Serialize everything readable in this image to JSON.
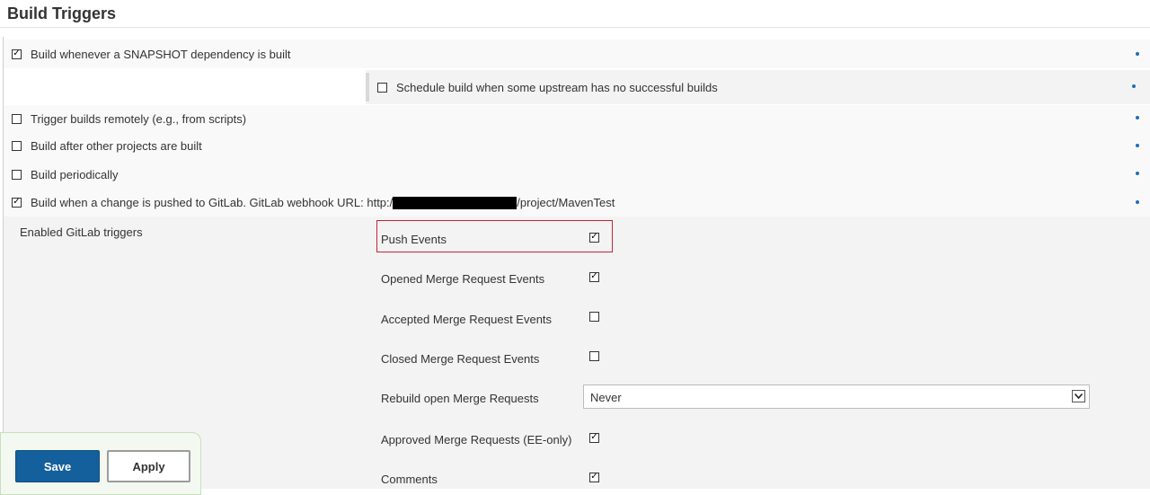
{
  "section": {
    "title": "Build Triggers"
  },
  "triggers": [
    {
      "label": "Build whenever a SNAPSHOT dependency is built",
      "checked": true
    },
    {
      "label": "Schedule build when some upstream has no successful builds",
      "checked": false
    },
    {
      "label": "Trigger builds remotely (e.g., from scripts)",
      "checked": false
    },
    {
      "label": "Build after other projects are built",
      "checked": false
    },
    {
      "label": "Build periodically",
      "checked": false
    },
    {
      "label_prefix": "Build when a change is pushed to GitLab. GitLab webhook URL: http:/",
      "label_suffix": "/project/MavenTest",
      "checked": true
    }
  ],
  "gitlab": {
    "panel_label": "Enabled GitLab triggers",
    "options": [
      {
        "label": "Push Events",
        "checked": true
      },
      {
        "label": "Opened Merge Request Events",
        "checked": true
      },
      {
        "label": "Accepted Merge Request Events",
        "checked": false
      },
      {
        "label": "Closed Merge Request Events",
        "checked": false
      },
      {
        "label": "Rebuild open Merge Requests",
        "select_value": "Never"
      },
      {
        "label": "Approved Merge Requests (EE-only)",
        "checked": true
      },
      {
        "label": "Comments",
        "checked": true
      }
    ]
  },
  "actions": {
    "save_label": "Save",
    "apply_label": "Apply"
  },
  "icons": {
    "check": "✓",
    "dropdown": "chevron-down-icon",
    "help": "help-dot-icon"
  },
  "colors": {
    "accent": "#14609c",
    "highlight": "#c82333",
    "help": "#1f6fb5"
  }
}
